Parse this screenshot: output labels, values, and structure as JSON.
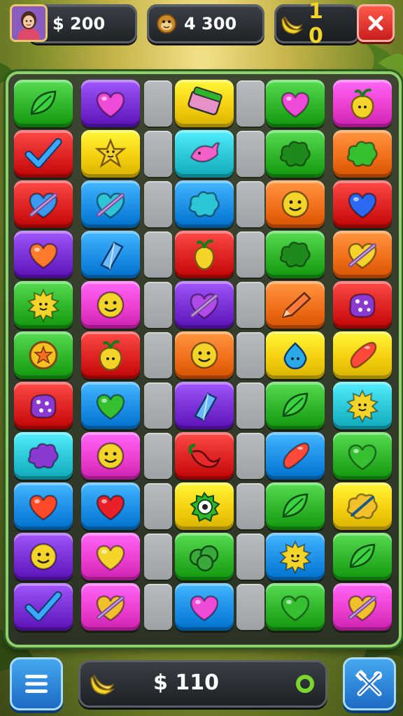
{
  "hud": {
    "money": {
      "icon": "dollar-sign",
      "value": "$ 200"
    },
    "score": {
      "icon": "monkey-face-icon",
      "value": "4 300"
    },
    "lives": {
      "icon": "banana-icon",
      "value": "1 0"
    },
    "close_icon": "close-icon"
  },
  "bottom": {
    "menu_icon": "hamburger-menu-icon",
    "coin_value": "$ 110",
    "banana_icon": "banana-icon",
    "status_icon": "green-ring-icon",
    "tools_icon": "crossed-tools-icon"
  },
  "colors": {
    "green": "#2fb52c",
    "purple": "#7a2fd6",
    "red": "#dc2222",
    "yellow": "#f5d010",
    "cyan": "#2cc6d8",
    "blue": "#1e8fe6",
    "orange": "#f2701c",
    "magenta": "#ec3fd0",
    "gap": "#a9adaf",
    "board_border": "#8ed06a"
  },
  "board": {
    "rows": 11,
    "columns": [
      "tile",
      "tile",
      "gap",
      "tile",
      "gap",
      "tile",
      "tile"
    ],
    "tiles": [
      [
        {
          "bg": "green",
          "icon": "leaf"
        },
        {
          "bg": "purple",
          "icon": "heart"
        },
        {
          "bg": "yellow",
          "icon": "striped-bar"
        },
        {
          "bg": "green",
          "icon": "heart"
        },
        {
          "bg": "magenta",
          "icon": "fruit-face"
        }
      ],
      [
        {
          "bg": "red",
          "icon": "check"
        },
        {
          "bg": "yellow",
          "icon": "star-creature"
        },
        {
          "bg": "cyan",
          "icon": "fish"
        },
        {
          "bg": "green",
          "icon": "splat"
        },
        {
          "bg": "orange",
          "icon": "splat"
        }
      ],
      [
        {
          "bg": "red",
          "icon": "heart-slash"
        },
        {
          "bg": "blue",
          "icon": "heart-slash"
        },
        {
          "bg": "blue",
          "icon": "splat"
        },
        {
          "bg": "orange",
          "icon": "smiley"
        },
        {
          "bg": "red",
          "icon": "heart"
        }
      ],
      [
        {
          "bg": "purple",
          "icon": "heart"
        },
        {
          "bg": "blue",
          "icon": "crystal"
        },
        {
          "bg": "red",
          "icon": "fruit"
        },
        {
          "bg": "green",
          "icon": "splat"
        },
        {
          "bg": "orange",
          "icon": "heart-slash"
        }
      ],
      [
        {
          "bg": "green",
          "icon": "sun-face"
        },
        {
          "bg": "magenta",
          "icon": "smiley"
        },
        {
          "bg": "purple",
          "icon": "heart-slash"
        },
        {
          "bg": "orange",
          "icon": "pencil"
        },
        {
          "bg": "red",
          "icon": "dotted-blob"
        }
      ],
      [
        {
          "bg": "green",
          "icon": "star-coin"
        },
        {
          "bg": "red",
          "icon": "fruit-face"
        },
        {
          "bg": "orange",
          "icon": "smiley"
        },
        {
          "bg": "yellow",
          "icon": "drop-face"
        },
        {
          "bg": "yellow",
          "icon": "bean"
        }
      ],
      [
        {
          "bg": "red",
          "icon": "dotted-blob"
        },
        {
          "bg": "blue",
          "icon": "heart"
        },
        {
          "bg": "purple",
          "icon": "crystal"
        },
        {
          "bg": "green",
          "icon": "leaf"
        },
        {
          "bg": "cyan",
          "icon": "sun-face"
        }
      ],
      [
        {
          "bg": "cyan",
          "icon": "splat"
        },
        {
          "bg": "magenta",
          "icon": "smiley"
        },
        {
          "bg": "red",
          "icon": "chili"
        },
        {
          "bg": "blue",
          "icon": "bean"
        },
        {
          "bg": "green",
          "icon": "heart"
        }
      ],
      [
        {
          "bg": "blue",
          "icon": "heart"
        },
        {
          "bg": "blue",
          "icon": "heart"
        },
        {
          "bg": "yellow",
          "icon": "eye-flower"
        },
        {
          "bg": "green",
          "icon": "leaf"
        },
        {
          "bg": "yellow",
          "icon": "splat-slash"
        }
      ],
      [
        {
          "bg": "purple",
          "icon": "smiley"
        },
        {
          "bg": "magenta",
          "icon": "heart"
        },
        {
          "bg": "green",
          "icon": "bush"
        },
        {
          "bg": "blue",
          "icon": "sun-face"
        },
        {
          "bg": "green",
          "icon": "leaf"
        }
      ],
      [
        {
          "bg": "purple",
          "icon": "check"
        },
        {
          "bg": "magenta",
          "icon": "heart-slash"
        },
        {
          "bg": "blue",
          "icon": "heart"
        },
        {
          "bg": "green",
          "icon": "heart"
        },
        {
          "bg": "magenta",
          "icon": "heart-slash"
        }
      ]
    ]
  }
}
